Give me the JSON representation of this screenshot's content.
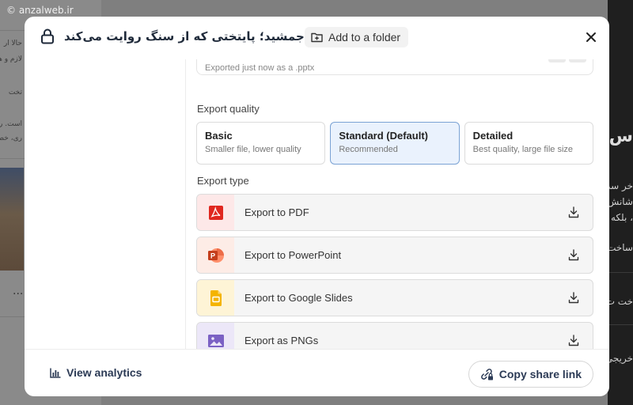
{
  "background": {
    "watermark": "© anzalweb.ir",
    "left_texts": [
      "حالا ار",
      "لازم و هر",
      "تخت",
      "است. رو",
      "ری، خط"
    ],
    "right_texts": [
      "س",
      "خر سد",
      "شانش",
      "، بلکه",
      "ساخت",
      "خت ت",
      "خریجی"
    ],
    "dots": "..."
  },
  "modal": {
    "title": "تخت جمشید؛ پایتختی که از سنگ روایت می‌کند Share",
    "add_to_folder_label": "Add to a folder",
    "exported_note": "Exported just now as a .pptx",
    "export_quality_label": "Export quality",
    "quality_options": [
      {
        "title": "Basic",
        "subtitle": "Smaller file, lower quality",
        "selected": false
      },
      {
        "title": "Standard (Default)",
        "subtitle": "Recommended",
        "selected": true
      },
      {
        "title": "Detailed",
        "subtitle": "Best quality, large file size",
        "selected": false
      }
    ],
    "export_type_label": "Export type",
    "export_options": [
      {
        "label": "Export to PDF",
        "icon": "pdf-icon",
        "color": "#e0271f",
        "bg": "#fde8e8"
      },
      {
        "label": "Export to PowerPoint",
        "icon": "powerpoint-icon",
        "color": "#d24726",
        "bg": "#fdece6"
      },
      {
        "label": "Export to Google Slides",
        "icon": "google-slides-icon",
        "color": "#f4b400",
        "bg": "#fef4d6"
      },
      {
        "label": "Export as PNGs",
        "icon": "image-icon",
        "color": "#7b61c4",
        "bg": "#ece7f8"
      }
    ],
    "footer": {
      "analytics_label": "View analytics",
      "copy_link_label": "Copy share link"
    }
  },
  "colors": {
    "accent_border": "#7aa2d4",
    "selected_bg": "#eaf2fd",
    "title_text": "#1f2a3a"
  }
}
